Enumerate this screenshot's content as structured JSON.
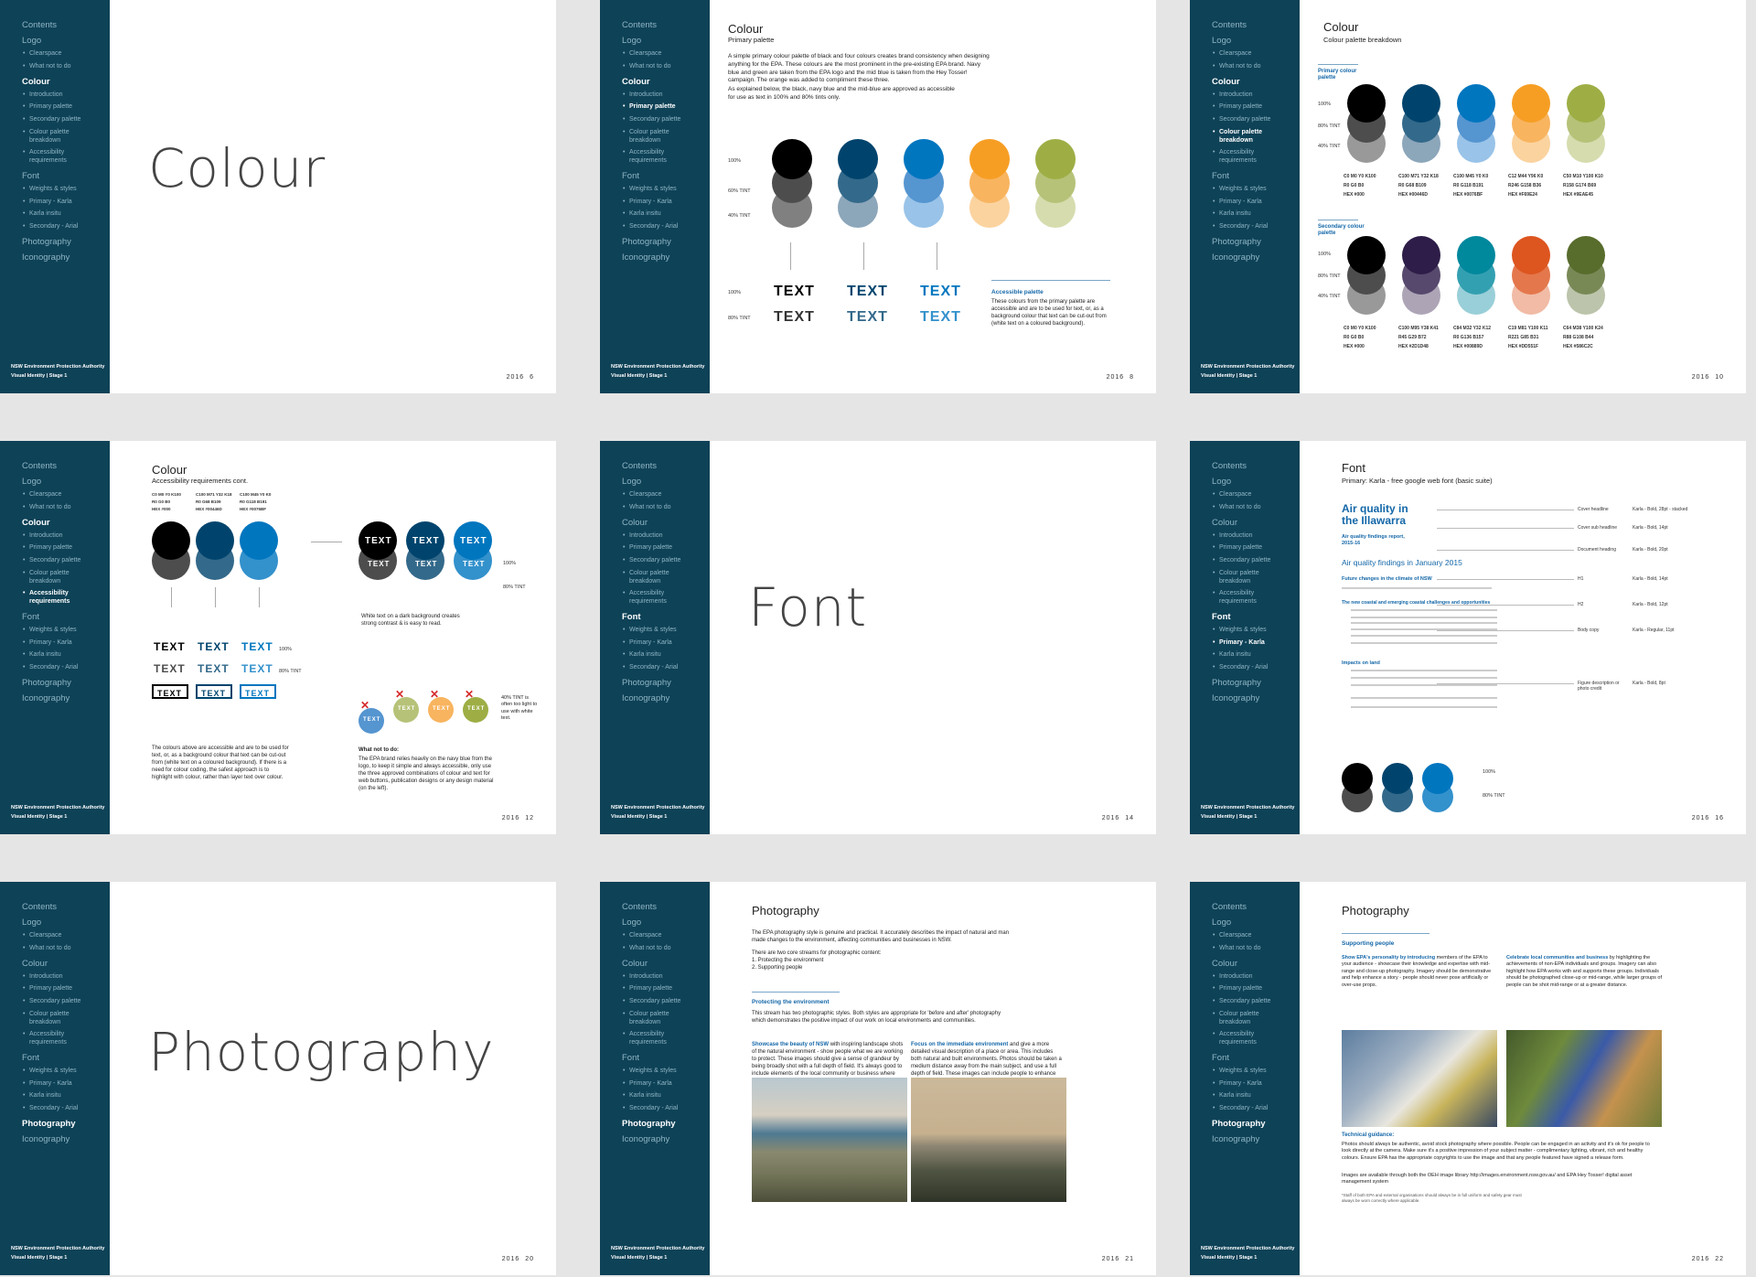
{
  "nav": {
    "contents": "Contents",
    "logo": "Logo",
    "clearspace": "Clearspace",
    "what_not": "What not to do",
    "colour": "Colour",
    "introduction": "Introduction",
    "primary_palette": "Primary palette",
    "secondary_palette": "Secondary palette",
    "colour_breakdown": "Colour palette breakdown",
    "accessibility": "Accessibility requirements",
    "font": "Font",
    "weights": "Weights & styles",
    "primary_karla": "Primary - Karla",
    "karla_insitu": "Karla insitu",
    "secondary_arial": "Secondary - Arial",
    "photography": "Photography",
    "iconography": "Iconography"
  },
  "footer": {
    "org": "NSW Environment Protection Authority",
    "vi": "Visual Identity | Stage 1",
    "year": "2016"
  },
  "slides": {
    "s1": {
      "title": "Colour",
      "page": "6"
    },
    "s2": {
      "title": "Colour",
      "subtitle": "Primary palette",
      "page": "8",
      "p1": "A simple primary colour palette of black and four colours creates brand consistency when designing anything for the EPA. These colours are the most prominent in the pre-existing EPA brand. Navy blue and green are taken from the EPA logo and the mid blue is taken from the Hey Tosser! campaign. The orange was added to compliment these three.",
      "p2": "As explained below, the black, navy blue and the mid-blue are approved as accessible for use as text in 100% and 80% tints only.",
      "t100": "100%",
      "t60": "60% TINT",
      "t40": "40% TINT",
      "text": "TEXT",
      "t80": "80% TINT",
      "acc_title": "Accessible palette",
      "acc_body": "These colours from the primary palette are accessible and are to be used for text, or, as a background colour that text can be cut-out from (white text on a coloured background)."
    },
    "s3": {
      "title": "Colour",
      "subtitle": "Colour palette breakdown",
      "page": "10",
      "primary_lbl": "Primary colour palette",
      "secondary_lbl": "Secondary colour palette",
      "t100": "100%",
      "t80": "80% TINT",
      "t40": "40% TINT",
      "primary_specs": [
        [
          "C0 M0 Y0 K100",
          "R0 G0 B0",
          "HEX #000"
        ],
        [
          "C100 M71 Y32 K18",
          "R0 G68 B109",
          "HEX #00446D"
        ],
        [
          "C100 M45 Y0 K0",
          "R0 G118 B191",
          "HEX #0076BF"
        ],
        [
          "C12 M44 Y96 K0",
          "R246 G158 B36",
          "HEX #F69E24"
        ],
        [
          "C50 M10 Y100 K10",
          "R158 G174 B69",
          "HEX #9EAE45"
        ]
      ],
      "secondary_specs": [
        [
          "C0 M0 Y0 K100",
          "R0 G0 B0",
          "HEX #000"
        ],
        [
          "C100 M95 Y38 K41",
          "R45 G29 B72",
          "HEX #2D1D48"
        ],
        [
          "C84 M32 Y32 K12",
          "R0 G136 B157",
          "HEX #00889D"
        ],
        [
          "C19 M81 Y100 K11",
          "R221 G85 B31",
          "HEX #DD551F"
        ],
        [
          "C64 M38 Y100 K24",
          "R88 G108 B44",
          "HEX #586C2C"
        ]
      ]
    },
    "s4": {
      "title": "Colour",
      "subtitle": "Accessibility requirements cont.",
      "page": "12",
      "specs": [
        [
          "C0 M0 Y0 K100",
          "R0 G0 B0",
          "HEX #000"
        ],
        [
          "C100 M71 Y32 K18",
          "R0 G68 B109",
          "HEX #00446D"
        ],
        [
          "C100 M45 Y0 K0",
          "R0 G118 B191",
          "HEX #0076BF"
        ]
      ],
      "text": "TEXT",
      "t100": "100%",
      "t80": "80% TINT",
      "white_note": "White text on a dark background creates strong contrast & is easy to read.",
      "tint_note": "40% TINT is often too light to use with white text.",
      "body": "The colours above are accessible and are to be used for text, or, as a background colour that text can be cut-out from (white text on a coloured background). If there is a need for colour coding, the safest approach is to highlight with colour, rather than layer text over colour.",
      "not_title": "What not to do:",
      "not_body": "The EPA brand relies heavily on the navy blue from the logo, to keep it simple and always accessible, only use the three approved combinations of colour and text for web buttons, publication designs or any design material (on the left)."
    },
    "s5": {
      "title": "Font",
      "page": "14"
    },
    "s6": {
      "title": "Font",
      "subtitle": "Primary: Karla - free google web font (basic suite)",
      "page": "16",
      "cover_heading": "Air quality in the Illawarra",
      "cover_sub": "Air quality findings report, 2015-16",
      "doc_heading": "Air quality findings in January 2015",
      "h1": "Future changes in the climate of NSW",
      "h2": "The new coastal and emerging coastal challenges and opportunities",
      "h3": "Impacts on land",
      "labels": [
        "Cover headline",
        "Cover sub headline",
        "Document heading",
        "H1",
        "H2",
        "Body copy",
        "Figure description or photo credit"
      ],
      "specs": [
        "Karla - Bold, 28pt - stacked",
        "Karla - Bold, 14pt",
        "Karla - Bold, 20pt",
        "Karla - Bold, 14pt",
        "Karla - Bold, 12pt",
        "Karla - Regular, 11pt",
        "Karla - Bold, 8pt"
      ],
      "t100": "100%",
      "t80": "80% TINT"
    },
    "s7": {
      "title": "Photography",
      "page": "20"
    },
    "s8": {
      "title": "Photography",
      "page": "21",
      "p1": "The EPA photography style is genuine and practical. It accurately describes the impact of natural and man made changes to the environment, affecting communities and businesses in NSW.",
      "p2": "There are two core streams for photographic content:",
      "list1": "1. Protecting the environment",
      "list2": "2. Supporting people",
      "section": "Protecting the environment",
      "p3": "This stream has two photographic styles. Both styles are appropriate for 'before and after' photography which demonstrates the positive impact of our work on local environments and communities.",
      "col1_lead": "Showcase the beauty of NSW",
      "col1": "with inspiring landscape shots of the natural environment - show people what we are working to protect. These images should give a sense of grandeur by being broadly shot with a full depth of field. It's always good to include elements of the local community or business where possible.",
      "col2_lead": "Focus on the immediate environment",
      "col2": "and give a more detailed visual description of a place or area. This includes both natural and built environments. Photos should be taken a medium distance away from the main subject, and use a full depth of field. These images can include people to enhance the story."
    },
    "s9": {
      "title": "Photography",
      "page": "22",
      "section": "Supporting people",
      "col1_lead": "Show EPA's personality by introducing",
      "col1": "members of the EPA to your audience - showcase their knowledge and expertise with mid-range and close-up photography. Imagery should be demonstrative and help enhance a story - people should never pose artificially or over-use props.",
      "col2_lead": "Celebrate local communities and business",
      "col2": "by highlighting the achievements of non-EPA individuals and groups. Imagery can also highlight how EPA works with and supports these groups. Individuals should be photographed close-up or mid-range, while larger groups of people can be shot mid-range or at a greater distance.",
      "tech_title": "Technical guidance:",
      "tech": "Photos should always be authentic, avoid stock photography where possible. People can be engaged in an activity and it's ok for people to look directly at the camera. Make sure it's a positive impression of your subject matter - complimentary lighting, vibrant, rich and healthy colours. Ensure EPA has the appropriate copyrights to use the image and that any people featured have signed a release form.",
      "images_line": "Images are available through both the OEH image library http://images.environment.nsw.gov.au/ and EPA Hey Tosser! digital asset management system",
      "note": "*Staff of both EPA and external organisations should always be in full uniform and safety gear must always be worn correctly where applicable."
    }
  }
}
